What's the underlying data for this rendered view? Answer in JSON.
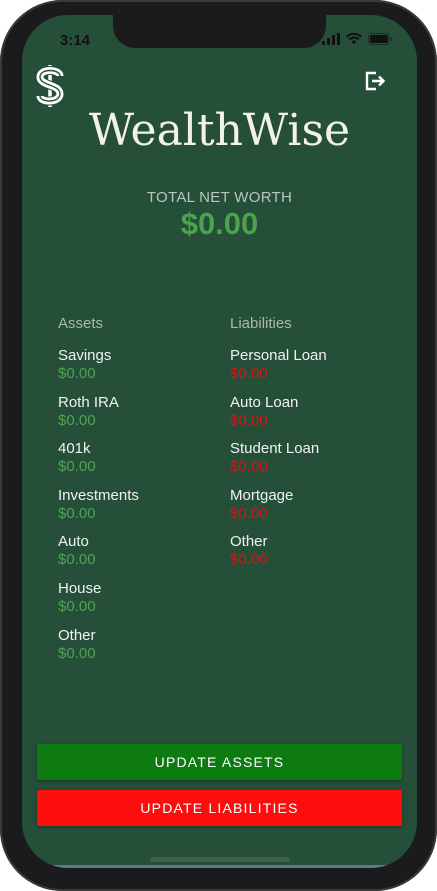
{
  "status_bar": {
    "time": "3:14",
    "icons": [
      "cellular-signal-icon",
      "wifi-icon",
      "battery-icon"
    ]
  },
  "header": {
    "title": "WealthWise",
    "logo_icon": "dollar-sign-icon",
    "logout_icon": "logout-icon"
  },
  "net_worth": {
    "label": "TOTAL NET WORTH",
    "value": "$0.00"
  },
  "assets": {
    "heading": "Assets",
    "items": [
      {
        "label": "Savings",
        "value": "$0.00"
      },
      {
        "label": "Roth IRA",
        "value": "$0.00"
      },
      {
        "label": "401k",
        "value": "$0.00"
      },
      {
        "label": "Investments",
        "value": "$0.00"
      },
      {
        "label": "Auto",
        "value": "$0.00"
      },
      {
        "label": "House",
        "value": "$0.00"
      },
      {
        "label": "Other",
        "value": "$0.00"
      }
    ]
  },
  "liabilities": {
    "heading": "Liabilities",
    "items": [
      {
        "label": "Personal Loan",
        "value": "$0.00"
      },
      {
        "label": "Auto Loan",
        "value": "$0.00"
      },
      {
        "label": "Student Loan",
        "value": "$0.00"
      },
      {
        "label": "Mortgage",
        "value": "$0.00"
      },
      {
        "label": "Other",
        "value": "$0.00"
      }
    ]
  },
  "buttons": {
    "update_assets": "UPDATE ASSETS",
    "update_liabilities": "UPDATE LIABILITIES"
  },
  "colors": {
    "background": "#254f38",
    "title": "#f4f1e6",
    "asset_value": "#4ea554",
    "liability_value": "#d61515",
    "update_assets_button": "#0d7b12",
    "update_liabilities_button": "#fd0d0d"
  }
}
